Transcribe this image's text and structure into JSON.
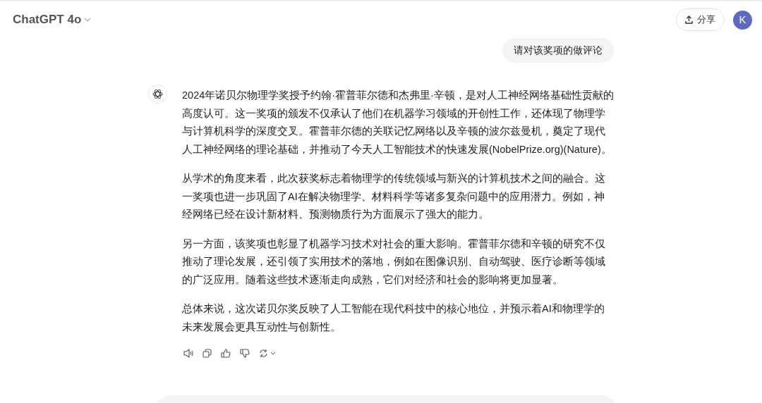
{
  "header": {
    "model_name": "ChatGPT 4o",
    "share_button": "分享",
    "avatar": "K"
  },
  "user_message": "请对该奖项的做评论",
  "assistant_message": {
    "paragraphs": [
      "2024年诺贝尔物理学奖授予约翰·霍普菲尔德和杰弗里·辛顿，是对人工神经网络基础性贡献的高度认可。这一奖项的颁发不仅承认了他们在机器学习领域的开创性工作，还体现了物理学与计算机科学的深度交叉。霍普菲尔德的关联记忆网络以及辛顿的波尔兹曼机，奠定了现代人工神经网络的理论基础，并推动了今天人工智能技术的快速发展(NobelPrize.org)(Nature)。",
      "从学术的角度来看，此次获奖标志着物理学的传统领域与新兴的计算机技术之间的融合。这一奖项也进一步巩固了AI在解决物理学、材料科学等诸多复杂问题中的应用潜力。例如，神经网络已经在设计新材料、预测物质行为方面展示了强大的能力。",
      "另一方面，该奖项也彰显了机器学习技术对社会的重大影响。霍普菲尔德和辛顿的研究不仅推动了理论发展，还引领了实用技术的落地，例如在图像识别、自动驾驶、医疗诊断等领域的广泛应用。随着这些技术逐渐走向成熟，它们对经济和社会的影响将更加显著。",
      "总体来说，这次诺贝尔奖反映了人工智能在现代科技中的核心地位，并预示着AI和物理学的未来发展会更具互动性与创新性。"
    ]
  }
}
